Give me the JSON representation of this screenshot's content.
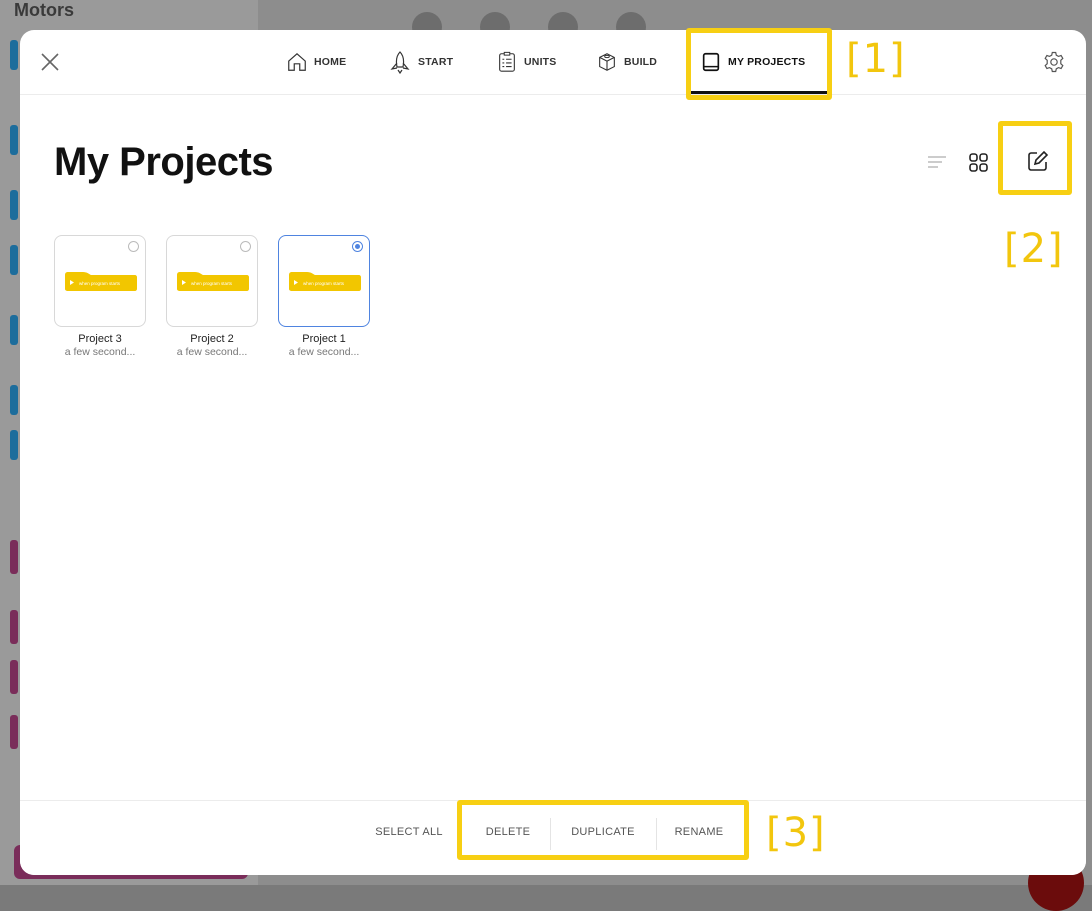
{
  "background": {
    "panel_title": "Motors"
  },
  "nav": {
    "items": [
      {
        "label": "HOME",
        "icon": "home-icon"
      },
      {
        "label": "START",
        "icon": "rocket-icon"
      },
      {
        "label": "UNITS",
        "icon": "checklist-icon"
      },
      {
        "label": "BUILD",
        "icon": "brick-icon"
      },
      {
        "label": "MY PROJECTS",
        "icon": "book-icon",
        "active": true
      }
    ]
  },
  "page": {
    "title": "My Projects"
  },
  "view": {
    "list_icon": "list-view-icon",
    "grid_icon": "grid-view-icon",
    "edit_icon": "edit-icon"
  },
  "projects": [
    {
      "name": "Project 3",
      "date": "a few second...",
      "selected": false
    },
    {
      "name": "Project 2",
      "date": "a few second...",
      "selected": false
    },
    {
      "name": "Project 1",
      "date": "a few second...",
      "selected": true
    }
  ],
  "block_text": "when program starts",
  "bottom": {
    "select_all": "SELECT ALL",
    "delete": "DELETE",
    "duplicate": "DUPLICATE",
    "rename": "RENAME"
  },
  "annotations": {
    "one": "[1]",
    "two": "[2]",
    "three": "[3]"
  },
  "colors": {
    "highlight": "#f7cf13",
    "accent_blue": "#4f84e0",
    "block_yellow": "#f2c600"
  }
}
